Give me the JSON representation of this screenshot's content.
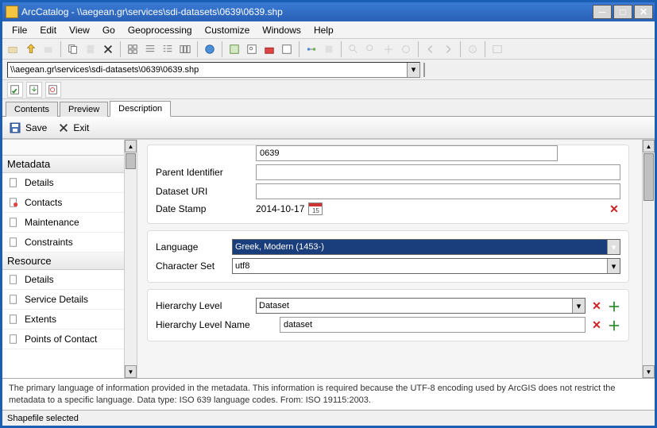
{
  "title": "ArcCatalog - \\\\aegean.gr\\services\\sdi-datasets\\0639\\0639.shp",
  "menus": [
    "File",
    "Edit",
    "View",
    "Go",
    "Geoprocessing",
    "Customize",
    "Windows",
    "Help"
  ],
  "address": "\\\\aegean.gr\\services\\sdi-datasets\\0639\\0639.shp",
  "tabs": {
    "contents": "Contents",
    "preview": "Preview",
    "description": "Description"
  },
  "subtoolbar": {
    "save": "Save",
    "exit": "Exit"
  },
  "sidebar": {
    "section_metadata": "Metadata",
    "section_resource": "Resource",
    "items_meta": [
      "Details",
      "Contacts",
      "Maintenance",
      "Constraints"
    ],
    "items_res": [
      "Details",
      "Service Details",
      "Extents",
      "Points of Contact"
    ]
  },
  "form": {
    "file_id_value": "0639",
    "parent_label": "Parent Identifier",
    "parent_value": "",
    "dataset_uri_label": "Dataset URI",
    "dataset_uri_value": "",
    "date_label": "Date Stamp",
    "date_value": "2014-10-17",
    "cal_day": "15",
    "language_label": "Language",
    "language_value": "Greek, Modern (1453-)",
    "charset_label": "Character Set",
    "charset_value": "utf8",
    "hierarchy_label": "Hierarchy Level",
    "hierarchy_value": "Dataset",
    "hierarchy_name_label": "Hierarchy Level Name",
    "hierarchy_name_value": "dataset"
  },
  "help": "The primary language of information provided in the metadata. This information is required because the UTF-8 encoding used by ArcGIS does not restrict the metadata to a specific language. Data type: ISO 639 language codes. From: ISO 19115:2003.",
  "status": "Shapefile selected"
}
